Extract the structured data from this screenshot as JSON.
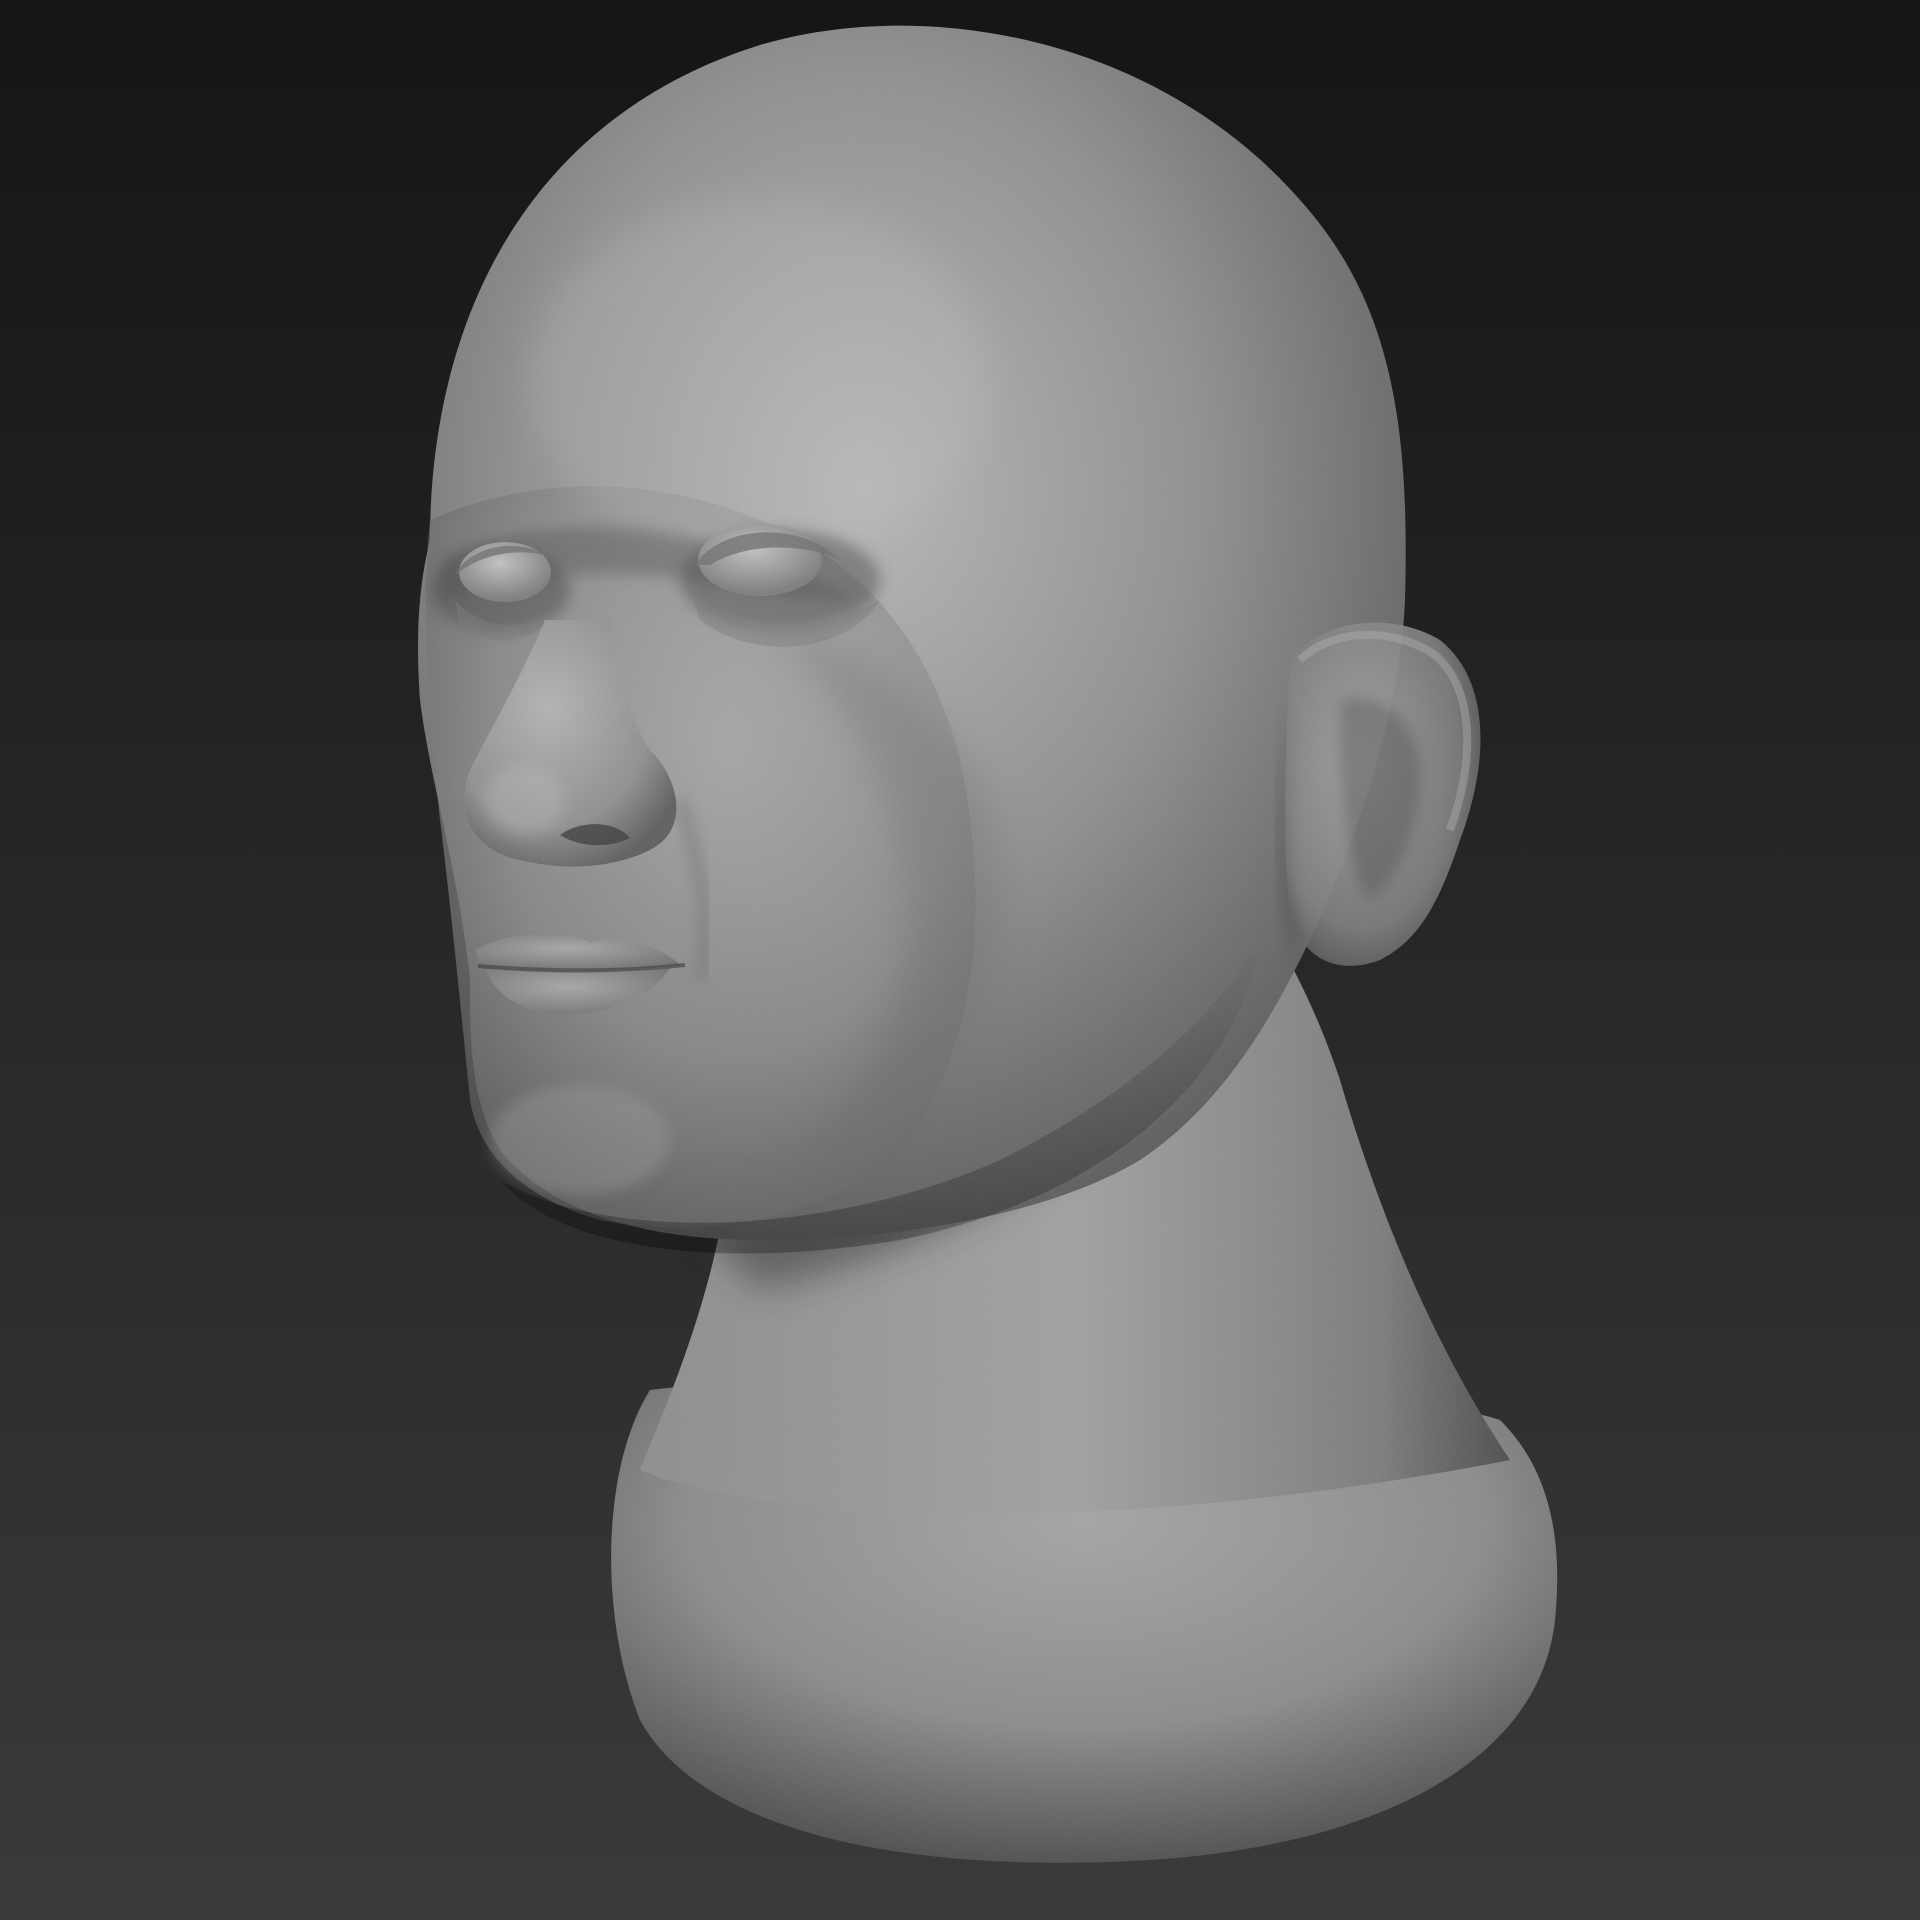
{
  "scene": {
    "subject": "",
    "colors": {
      "background_top": "#151515",
      "background_bottom": "#3a3a3a",
      "material_light": "#b4b4b4",
      "material_mid": "#8a8a8a",
      "material_shadow": "#3c3c3c"
    }
  }
}
